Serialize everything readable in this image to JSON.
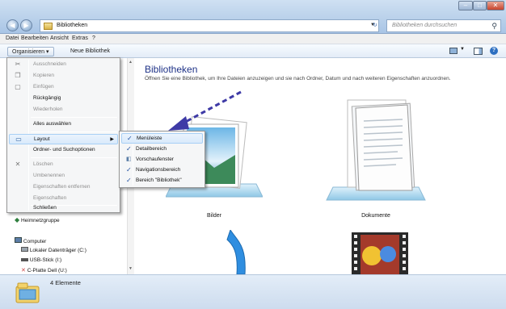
{
  "window": {
    "min_label": "–",
    "max_label": "□",
    "close_label": "✕"
  },
  "address": {
    "path": "Bibliotheken",
    "search_placeholder": "Bibliotheken durchsuchen"
  },
  "menubar": [
    "Datei",
    "Bearbeiten",
    "Ansicht",
    "Extras",
    "?"
  ],
  "commandbar": {
    "organize": "Organisieren ▾",
    "new_library": "Neue Bibliothek"
  },
  "content": {
    "title": "Bibliotheken",
    "subtitle": "Öffnen Sie eine Bibliothek, um Ihre Dateien anzuzeigen und sie nach Ordner, Datum und nach weiteren Eigenschaften anzuordnen.",
    "libraries": [
      {
        "name": "Bilder"
      },
      {
        "name": "Dokumente"
      }
    ]
  },
  "organize_menu": {
    "items": [
      {
        "label": "Ausschneiden",
        "enabled": false,
        "icon": "scissors-icon"
      },
      {
        "label": "Kopieren",
        "enabled": false,
        "icon": "copy-icon"
      },
      {
        "label": "Einfügen",
        "enabled": false,
        "icon": "paste-icon"
      },
      {
        "label": "Rückgängig",
        "enabled": true
      },
      {
        "label": "Wiederholen",
        "enabled": false
      },
      {
        "label": "Alles auswählen",
        "enabled": true
      },
      {
        "label": "Layout",
        "enabled": true,
        "highlighted": true,
        "submenu": true
      },
      {
        "label": "Ordner- und Suchoptionen",
        "enabled": true
      },
      {
        "label": "Löschen",
        "enabled": false,
        "icon": "delete-icon"
      },
      {
        "label": "Umbenennen",
        "enabled": false
      },
      {
        "label": "Eigenschaften entfernen",
        "enabled": false
      },
      {
        "label": "Eigenschaften",
        "enabled": false
      },
      {
        "label": "Schließen",
        "enabled": true
      }
    ]
  },
  "layout_submenu": {
    "items": [
      {
        "label": "Menüleiste",
        "checked": true,
        "highlighted": true
      },
      {
        "label": "Detailbereich",
        "checked": true
      },
      {
        "label": "Vorschaufenster",
        "checked": false
      },
      {
        "label": "Navigationsbereich",
        "checked": true
      },
      {
        "label": "Bereich \"Bibliothek\"",
        "checked": true
      }
    ]
  },
  "navpane": {
    "homegroup": "Heimnetzgruppe",
    "computer": "Computer",
    "drives": [
      "Lokaler Datenträger (C:)",
      "USB-Stick (I:)",
      "C-Platte Dell (U:)"
    ]
  },
  "status": {
    "count": "4 Elemente"
  },
  "colors": {
    "accent_title": "#1e3287",
    "arrow": "#3e3aa6",
    "menu_highlight": "#d9eafb"
  }
}
